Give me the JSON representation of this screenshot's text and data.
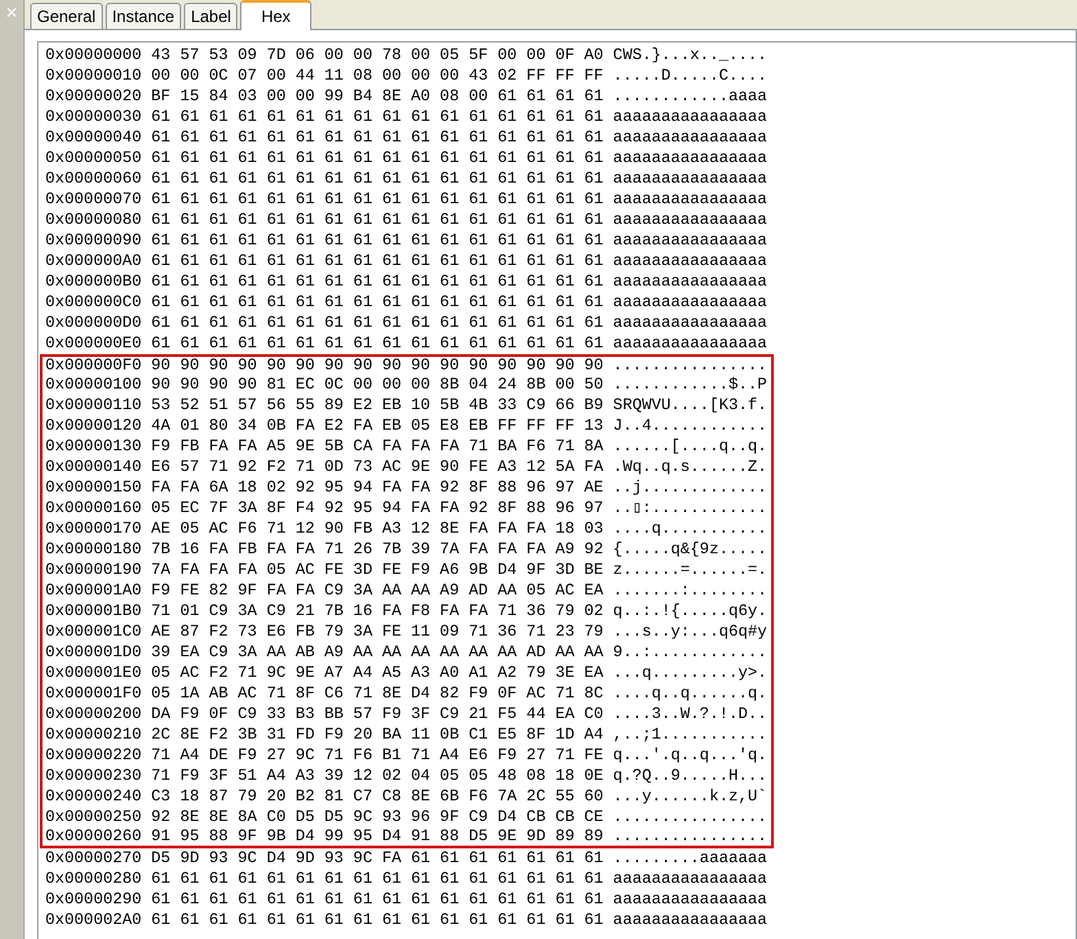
{
  "close_button": {
    "label": "×"
  },
  "tabs": [
    {
      "label": "General",
      "selected": false
    },
    {
      "label": "Instance",
      "selected": false
    },
    {
      "label": "Label",
      "selected": false
    },
    {
      "label": "Hex",
      "selected": true
    }
  ],
  "rows": [
    {
      "address": "0x00000000",
      "bytes": "43 57 53 09 7D 06 00 00 78 00 05 5F 00 00 0F A0",
      "ascii": "CWS.}...x.._....",
      "selected": false
    },
    {
      "address": "0x00000010",
      "bytes": "00 00 0C 07 00 44 11 08 00 00 00 43 02 FF FF FF",
      "ascii": ".....D.....C....",
      "selected": false
    },
    {
      "address": "0x00000020",
      "bytes": "BF 15 84 03 00 00 99 B4 8E A0 08 00 61 61 61 61",
      "ascii": "............aaaa",
      "selected": false
    },
    {
      "address": "0x00000030",
      "bytes": "61 61 61 61 61 61 61 61 61 61 61 61 61 61 61 61",
      "ascii": "aaaaaaaaaaaaaaaa",
      "selected": false
    },
    {
      "address": "0x00000040",
      "bytes": "61 61 61 61 61 61 61 61 61 61 61 61 61 61 61 61",
      "ascii": "aaaaaaaaaaaaaaaa",
      "selected": false
    },
    {
      "address": "0x00000050",
      "bytes": "61 61 61 61 61 61 61 61 61 61 61 61 61 61 61 61",
      "ascii": "aaaaaaaaaaaaaaaa",
      "selected": false
    },
    {
      "address": "0x00000060",
      "bytes": "61 61 61 61 61 61 61 61 61 61 61 61 61 61 61 61",
      "ascii": "aaaaaaaaaaaaaaaa",
      "selected": false
    },
    {
      "address": "0x00000070",
      "bytes": "61 61 61 61 61 61 61 61 61 61 61 61 61 61 61 61",
      "ascii": "aaaaaaaaaaaaaaaa",
      "selected": false
    },
    {
      "address": "0x00000080",
      "bytes": "61 61 61 61 61 61 61 61 61 61 61 61 61 61 61 61",
      "ascii": "aaaaaaaaaaaaaaaa",
      "selected": false
    },
    {
      "address": "0x00000090",
      "bytes": "61 61 61 61 61 61 61 61 61 61 61 61 61 61 61 61",
      "ascii": "aaaaaaaaaaaaaaaa",
      "selected": false
    },
    {
      "address": "0x000000A0",
      "bytes": "61 61 61 61 61 61 61 61 61 61 61 61 61 61 61 61",
      "ascii": "aaaaaaaaaaaaaaaa",
      "selected": false
    },
    {
      "address": "0x000000B0",
      "bytes": "61 61 61 61 61 61 61 61 61 61 61 61 61 61 61 61",
      "ascii": "aaaaaaaaaaaaaaaa",
      "selected": false
    },
    {
      "address": "0x000000C0",
      "bytes": "61 61 61 61 61 61 61 61 61 61 61 61 61 61 61 61",
      "ascii": "aaaaaaaaaaaaaaaa",
      "selected": false
    },
    {
      "address": "0x000000D0",
      "bytes": "61 61 61 61 61 61 61 61 61 61 61 61 61 61 61 61",
      "ascii": "aaaaaaaaaaaaaaaa",
      "selected": false
    },
    {
      "address": "0x000000E0",
      "bytes": "61 61 61 61 61 61 61 61 61 61 61 61 61 61 61 61",
      "ascii": "aaaaaaaaaaaaaaaa",
      "selected": false
    },
    {
      "address": "0x000000F0",
      "bytes": "90 90 90 90 90 90 90 90 90 90 90 90 90 90 90 90",
      "ascii": "................",
      "selected": true
    },
    {
      "address": "0x00000100",
      "bytes": "90 90 90 90 81 EC 0C 00 00 00 8B 04 24 8B 00 50",
      "ascii": "............$..P",
      "selected": true
    },
    {
      "address": "0x00000110",
      "bytes": "53 52 51 57 56 55 89 E2 EB 10 5B 4B 33 C9 66 B9",
      "ascii": "SRQWVU....[K3.f.",
      "selected": true
    },
    {
      "address": "0x00000120",
      "bytes": "4A 01 80 34 0B FA E2 FA EB 05 E8 EB FF FF FF 13",
      "ascii": "J..4............",
      "selected": true
    },
    {
      "address": "0x00000130",
      "bytes": "F9 FB FA FA A5 9E 5B CA FA FA FA 71 BA F6 71 8A",
      "ascii": "......[....q..q.",
      "selected": true
    },
    {
      "address": "0x00000140",
      "bytes": "E6 57 71 92 F2 71 0D 73 AC 9E 90 FE A3 12 5A FA",
      "ascii": ".Wq..q.s......Z.",
      "selected": true
    },
    {
      "address": "0x00000150",
      "bytes": "FA FA 6A 18 02 92 95 94 FA FA 92 8F 88 96 97 AE",
      "ascii": "..j.............",
      "selected": true
    },
    {
      "address": "0x00000160",
      "bytes": "05 EC 7F 3A 8F F4 92 95 94 FA FA 92 8F 88 96 97",
      "ascii": "..▯:............",
      "selected": true
    },
    {
      "address": "0x00000170",
      "bytes": "AE 05 AC F6 71 12 90 FB A3 12 8E FA FA FA 18 03",
      "ascii": "....q...........",
      "selected": true
    },
    {
      "address": "0x00000180",
      "bytes": "7B 16 FA FB FA FA 71 26 7B 39 7A FA FA FA A9 92",
      "ascii": "{.....q&{9z.....",
      "selected": true
    },
    {
      "address": "0x00000190",
      "bytes": "7A FA FA FA 05 AC FE 3D FE F9 A6 9B D4 9F 3D BE",
      "ascii": "z......=......=.",
      "selected": true
    },
    {
      "address": "0x000001A0",
      "bytes": "F9 FE 82 9F FA FA C9 3A AA AA A9 AD AA 05 AC EA",
      "ascii": ".......:........",
      "selected": true
    },
    {
      "address": "0x000001B0",
      "bytes": "71 01 C9 3A C9 21 7B 16 FA F8 FA FA 71 36 79 02",
      "ascii": "q..:.!{.....q6y.",
      "selected": true
    },
    {
      "address": "0x000001C0",
      "bytes": "AE 87 F2 73 E6 FB 79 3A FE 11 09 71 36 71 23 79",
      "ascii": "...s..y:...q6q#y",
      "selected": true
    },
    {
      "address": "0x000001D0",
      "bytes": "39 EA C9 3A AA AB A9 AA AA AA AA AA AA AD AA AA",
      "ascii": "9..:............",
      "selected": true
    },
    {
      "address": "0x000001E0",
      "bytes": "05 AC F2 71 9C 9E A7 A4 A5 A3 A0 A1 A2 79 3E EA",
      "ascii": "...q.........y>.",
      "selected": true
    },
    {
      "address": "0x000001F0",
      "bytes": "05 1A AB AC 71 8F C6 71 8E D4 82 F9 0F AC 71 8C",
      "ascii": "....q..q......q.",
      "selected": true
    },
    {
      "address": "0x00000200",
      "bytes": "DA F9 0F C9 33 B3 BB 57 F9 3F C9 21 F5 44 EA C0",
      "ascii": "....3..W.?.!.D..",
      "selected": true
    },
    {
      "address": "0x00000210",
      "bytes": "2C 8E F2 3B 31 FD F9 20 BA 11 0B C1 E5 8F 1D A4",
      "ascii": ",..;1...........",
      "selected": true
    },
    {
      "address": "0x00000220",
      "bytes": "71 A4 DE F9 27 9C 71 F6 B1 71 A4 E6 F9 27 71 FE",
      "ascii": "q...'.q..q...'q.",
      "selected": true
    },
    {
      "address": "0x00000230",
      "bytes": "71 F9 3F 51 A4 A3 39 12 02 04 05 05 48 08 18 0E",
      "ascii": "q.?Q..9.....H...",
      "selected": true
    },
    {
      "address": "0x00000240",
      "bytes": "C3 18 87 79 20 B2 81 C7 C8 8E 6B F6 7A 2C 55 60",
      "ascii": "...y......k.z,U`",
      "selected": true
    },
    {
      "address": "0x00000250",
      "bytes": "92 8E 8E 8A C0 D5 D5 9C 93 96 9F C9 D4 CB CB CE",
      "ascii": "................",
      "selected": true
    },
    {
      "address": "0x00000260",
      "bytes": "91 95 88 9F 9B D4 99 95 D4 91 88 D5 9E 9D 89 89",
      "ascii": "................",
      "selected": true
    },
    {
      "address": "0x00000270",
      "bytes": "D5 9D 93 9C D4 9D 93 9C FA 61 61 61 61 61 61 61",
      "ascii": ".........aaaaaaa",
      "selected": false
    },
    {
      "address": "0x00000280",
      "bytes": "61 61 61 61 61 61 61 61 61 61 61 61 61 61 61 61",
      "ascii": "aaaaaaaaaaaaaaaa",
      "selected": false
    },
    {
      "address": "0x00000290",
      "bytes": "61 61 61 61 61 61 61 61 61 61 61 61 61 61 61 61",
      "ascii": "aaaaaaaaaaaaaaaa",
      "selected": false
    },
    {
      "address": "0x000002A0",
      "bytes": "61 61 61 61 61 61 61 61 61 61 61 61 61 61 61 61",
      "ascii": "aaaaaaaaaaaaaaaa",
      "selected": false
    }
  ]
}
